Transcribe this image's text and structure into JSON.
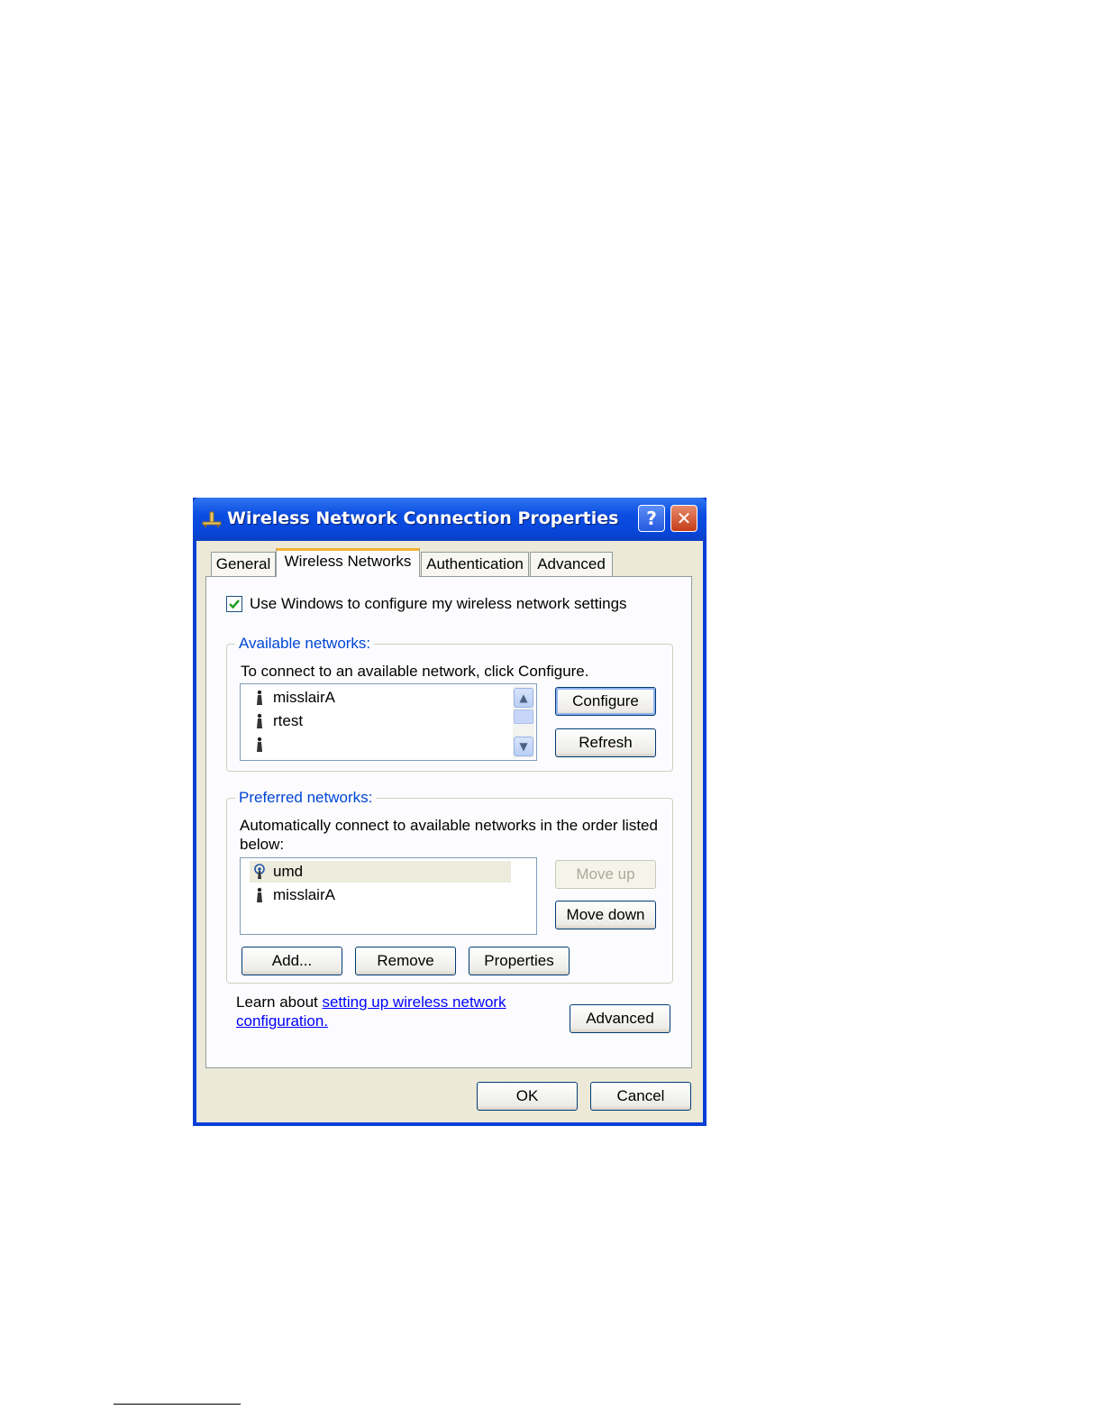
{
  "window": {
    "title": "Wireless Network Connection Properties",
    "help_label": "?",
    "close_label": "✕"
  },
  "tabs": [
    {
      "label": "General"
    },
    {
      "label": "Wireless Networks",
      "active": true
    },
    {
      "label": "Authentication"
    },
    {
      "label": "Advanced"
    }
  ],
  "use_windows": {
    "checked": true,
    "label": "Use Windows to configure my wireless network settings"
  },
  "available": {
    "group_label": "Available networks:",
    "instruction": "To connect to an available network, click Configure.",
    "items": [
      {
        "name": "misslairA",
        "icon": "wireless-antenna-icon"
      },
      {
        "name": "rtest",
        "icon": "wireless-antenna-icon"
      },
      {
        "name": "",
        "icon": "wireless-antenna-icon"
      }
    ],
    "configure_label": "Configure",
    "refresh_label": "Refresh"
  },
  "preferred": {
    "group_label": "Preferred networks:",
    "instruction_line1": "Automatically connect to available networks in the order listed",
    "instruction_line2": "below:",
    "items": [
      {
        "name": "umd",
        "icon": "wireless-connected-icon",
        "selected": true
      },
      {
        "name": "misslairA",
        "icon": "wireless-antenna-icon"
      }
    ],
    "move_up_label": "Move up",
    "move_down_label": "Move down",
    "add_label": "Add...",
    "remove_label": "Remove",
    "properties_label": "Properties"
  },
  "learn": {
    "prefix": "Learn about ",
    "link_line1": "setting up wireless network",
    "link_line2": "configuration.",
    "advanced_label": "Advanced"
  },
  "footer": {
    "ok_label": "OK",
    "cancel_label": "Cancel"
  },
  "colors": {
    "titlebar": "#0a3fd6",
    "dialog_bg": "#ece9d8",
    "group_label": "#0046d5",
    "link": "#0000ff",
    "tab_highlight": "#f7b233"
  }
}
